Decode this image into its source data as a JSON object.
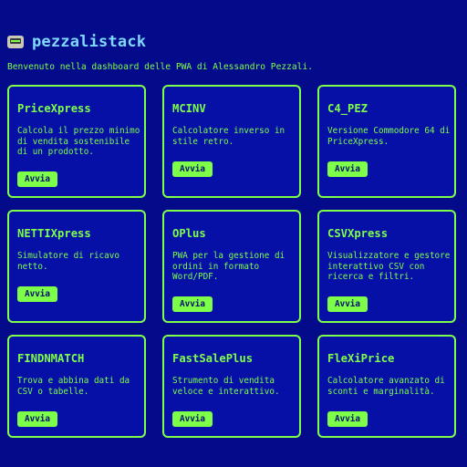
{
  "header": {
    "title": "pezzalistack",
    "logo_icon": "computer-icon"
  },
  "subtitle": "Benvenuto nella dashboard delle PWA di Alessandro Pezzali.",
  "colors": {
    "background": "#040b8a",
    "card": "#060fa6",
    "accent": "#7dff4a",
    "title": "#7fd9ff"
  },
  "cards": [
    {
      "title": "PriceXpress",
      "description": "Calcola il prezzo minimo di vendita sostenibile di un prodotto.",
      "button": "Avvia"
    },
    {
      "title": "MCINV",
      "description": "Calcolatore inverso in stile retro.",
      "button": "Avvia"
    },
    {
      "title": "C4_PEZ",
      "description": "Versione Commodore 64 di PriceXpress.",
      "button": "Avvia"
    },
    {
      "title": "NETTIXpress",
      "description": "Simulatore di ricavo netto.",
      "button": "Avvia"
    },
    {
      "title": "OPlus",
      "description": "PWA per la gestione di ordini in formato Word/PDF.",
      "button": "Avvia"
    },
    {
      "title": "CSVXpress",
      "description": "Visualizzatore e gestore interattivo CSV con ricerca e filtri.",
      "button": "Avvia"
    },
    {
      "title": "FINDNMATCH",
      "description": "Trova e abbina dati da CSV o tabelle.",
      "button": "Avvia"
    },
    {
      "title": "FastSalePlus",
      "description": "Strumento di vendita veloce e interattivo.",
      "button": "Avvia"
    },
    {
      "title": "FleXiPrice",
      "description": "Calcolatore avanzato di sconti e marginalità.",
      "button": "Avvia"
    }
  ]
}
